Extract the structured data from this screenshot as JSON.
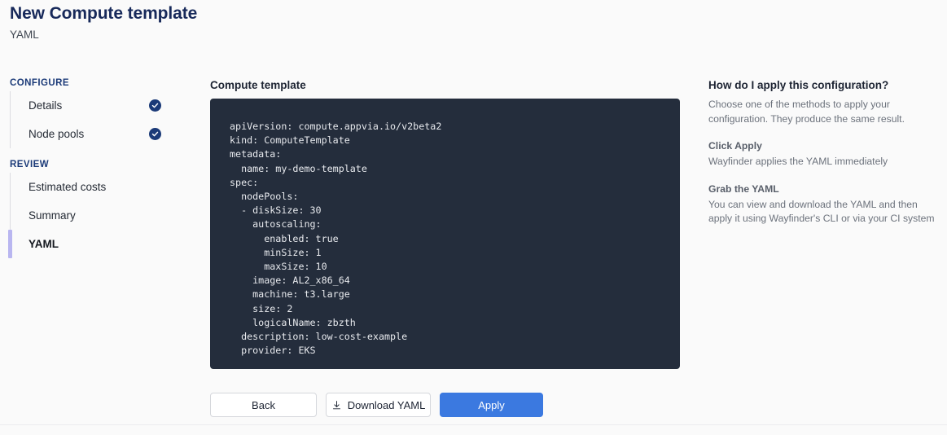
{
  "header": {
    "title": "New Compute template",
    "subtitle": "YAML"
  },
  "sidebar": {
    "groups": [
      {
        "label": "CONFIGURE",
        "items": [
          {
            "label": "Details",
            "completed": true,
            "active": false,
            "icon": "check-circle-icon"
          },
          {
            "label": "Node pools",
            "completed": true,
            "active": false,
            "icon": "check-circle-icon"
          }
        ]
      },
      {
        "label": "REVIEW",
        "items": [
          {
            "label": "Estimated costs",
            "completed": false,
            "active": false
          },
          {
            "label": "Summary",
            "completed": false,
            "active": false
          },
          {
            "label": "YAML",
            "completed": false,
            "active": true
          }
        ]
      }
    ],
    "active_indicator_color": "#b9b6f0",
    "check_color": "#1b3a78"
  },
  "main": {
    "section_title": "Compute template",
    "code_background": "#242d3c",
    "yaml": "apiVersion: compute.appvia.io/v2beta2\nkind: ComputeTemplate\nmetadata:\n  name: my-demo-template\nspec:\n  nodePools:\n  - diskSize: 30\n    autoscaling:\n      enabled: true\n      minSize: 1\n      maxSize: 10\n    image: AL2_x86_64\n    machine: t3.large\n    size: 2\n    logicalName: zbzth\n  description: low-cost-example\n  provider: EKS"
  },
  "actions": {
    "back_label": "Back",
    "download_label": "Download YAML",
    "download_icon": "download-icon",
    "apply_label": "Apply",
    "apply_color": "#3b79e0"
  },
  "help": {
    "title": "How do I apply this configuration?",
    "lead": "Choose one of the methods to apply your configuration. They produce the same result.",
    "sections": [
      {
        "heading": "Click Apply",
        "body": "Wayfinder applies the YAML immediately"
      },
      {
        "heading": "Grab the YAML",
        "body": "You can view and download the YAML and then apply it using Wayfinder's CLI or via your CI system"
      }
    ]
  }
}
